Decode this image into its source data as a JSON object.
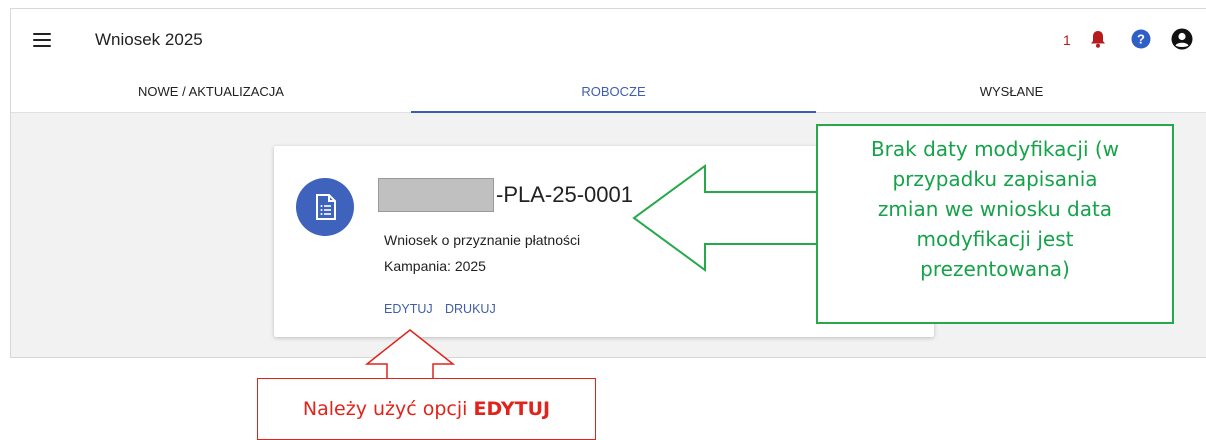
{
  "header": {
    "title": "Wniosek 2025",
    "notification_count": "1",
    "icons": [
      "menu-icon",
      "bell-icon",
      "help-icon",
      "user-icon"
    ]
  },
  "tabs": [
    {
      "label": "NOWE / AKTUALIZACJA",
      "active": false
    },
    {
      "label": "ROBOCZE",
      "active": true
    },
    {
      "label": "WYSŁANE",
      "active": false
    }
  ],
  "card": {
    "icon": "document-icon",
    "id_suffix": "-PLA-25-0001",
    "description": "Wniosek o przyznanie płatności",
    "campaign": "Kampania: 2025",
    "actions": {
      "edit": "EDYTUJ",
      "print": "DRUKUJ"
    }
  },
  "annotations": {
    "green": {
      "lines": [
        "Brak daty modyfikacji (w",
        "przypadku zapisania",
        "zmian we wniosku data",
        "modyfikacji jest",
        "prezentowana)"
      ]
    },
    "red": {
      "prefix": "Należy użyć opcji ",
      "emphasis": "EDYTUJ"
    }
  },
  "colors": {
    "accent": "#3f5dab",
    "avatar": "#3f62bc",
    "bell": "#b71c1c",
    "help": "#2f5fc6",
    "callout_green": "#27a84b",
    "callout_red": "#e0241b"
  }
}
